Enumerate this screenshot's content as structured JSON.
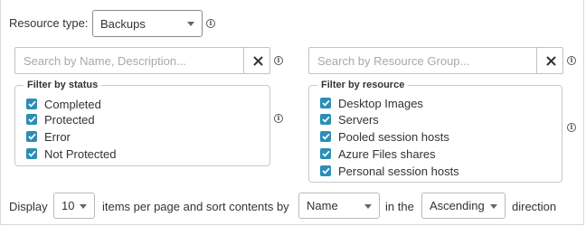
{
  "resource_type": {
    "label": "Resource type:",
    "value": "Backups"
  },
  "search_name": {
    "placeholder": "Search by Name, Description..."
  },
  "search_group": {
    "placeholder": "Search by Resource Group..."
  },
  "filter_status": {
    "legend": "Filter by status",
    "items": [
      {
        "label": "Completed",
        "checked": true
      },
      {
        "label": "Protected",
        "checked": true
      },
      {
        "label": "Error",
        "checked": true
      },
      {
        "label": "Not Protected",
        "checked": true
      }
    ]
  },
  "filter_resource": {
    "legend": "Filter by resource",
    "items": [
      {
        "label": "Desktop Images",
        "checked": true
      },
      {
        "label": "Servers",
        "checked": true
      },
      {
        "label": "Pooled session hosts",
        "checked": true
      },
      {
        "label": "Azure Files shares",
        "checked": true
      },
      {
        "label": "Personal session hosts",
        "checked": true
      }
    ]
  },
  "footer": {
    "display_label": "Display",
    "per_page_value": "10",
    "middle_text": "items per page and sort contents by",
    "sort_field_value": "Name",
    "in_the_text": "in the",
    "sort_order_value": "Ascending",
    "direction_text": "direction"
  },
  "colors": {
    "checkbox": "#2b8eb6",
    "border": "#c9c9c9"
  },
  "icons": {
    "info": "info-circle-icon",
    "clear": "close-icon",
    "dropdown": "chevron-down-icon",
    "check": "check-icon"
  }
}
